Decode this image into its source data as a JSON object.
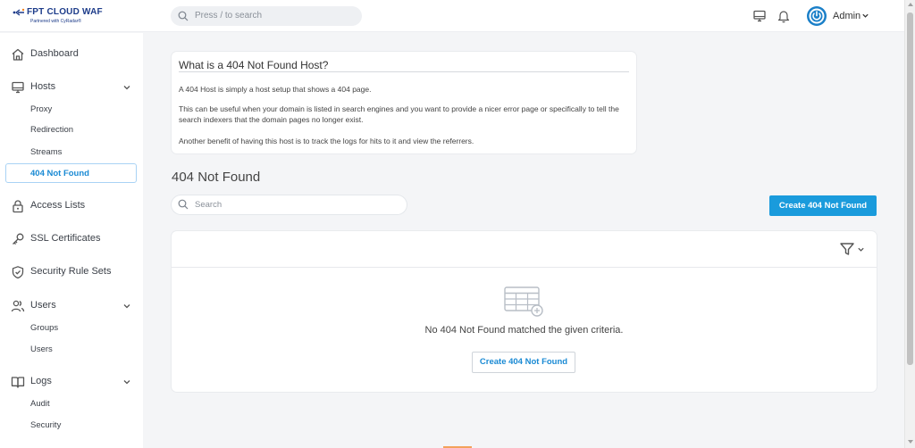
{
  "brand": {
    "name": "FPT CLOUD  WAF",
    "tagline": "Partnered with CyRadar®",
    "color": "#1d3c8a"
  },
  "header": {
    "search_placeholder": "Press / to search",
    "user_name": "Admin",
    "icons": [
      "monitor-icon",
      "bell-icon",
      "power-icon",
      "chevron-down-icon"
    ]
  },
  "sidebar": {
    "dashboard": "Dashboard",
    "hosts": {
      "label": "Hosts",
      "items": [
        "Proxy",
        "Redirection",
        "Streams",
        "404 Not Found"
      ],
      "active": "404 Not Found"
    },
    "access_lists": "Access Lists",
    "ssl_certificates": "SSL Certificates",
    "security_rule_sets": "Security Rule Sets",
    "users": {
      "label": "Users",
      "items": [
        "Groups",
        "Users"
      ]
    },
    "logs": {
      "label": "Logs",
      "items": [
        "Audit",
        "Security"
      ]
    }
  },
  "info": {
    "title": "What is a 404 Not Found Host?",
    "paragraphs": [
      "A 404 Host is simply a host setup that shows a 404 page.",
      "This can be useful when your domain is listed in search engines and you want to provide a nicer error page or specifically to tell the search indexers that the domain pages no longer exist.",
      "Another benefit of having this host is to track the logs for hits to it and view the referrers."
    ]
  },
  "main": {
    "title": "404 Not Found",
    "search_placeholder": "Search",
    "create_button": "Create 404 Not Found",
    "empty_message": "No 404 Not Found matched the given criteria.",
    "empty_create_button": "Create 404 Not Found"
  },
  "colors": {
    "accent": "#1a9bdc",
    "active_border": "#a9d3f5",
    "active_text": "#1a8ad4"
  }
}
